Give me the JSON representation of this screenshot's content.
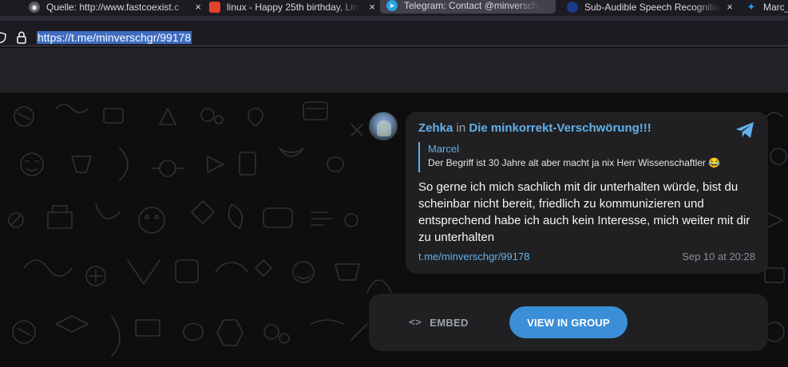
{
  "browser": {
    "tabs": [
      {
        "label": "Quelle: http://www.fastcoexist.c",
        "icon": "globe-icon"
      },
      {
        "label": "linux - Happy 25th birthday, Lin",
        "icon": "gitlab-fox-icon"
      },
      {
        "label": "Telegram: Contact @minverschgr",
        "icon": "telegram-icon",
        "active": true
      },
      {
        "label": "Sub-Audible Speech Recognitio",
        "icon": "nasa-icon"
      },
      {
        "label": "Marc_",
        "icon": "twitter-icon"
      }
    ],
    "url": "https://t.me/minverschgr/99178"
  },
  "message": {
    "author": "Zehka",
    "in_word": "in",
    "group": "Die minkorrekt-Verschwörung!!!",
    "reply_name": "Marcel",
    "reply_text": "Der Begriff ist 30 Jahre alt aber macht ja nix Herr Wissenschaftler 😂",
    "text": "So gerne ich mich sachlich mit dir unterhalten würde, bist du scheinbar nicht bereit, friedlich zu kommunizieren und entsprechend habe ich auch kein Interesse, mich weiter mit dir zu unterhalten",
    "link": "t.me/minverschgr/99178",
    "time": "Sep 10 at 20:28"
  },
  "actions": {
    "embed_icon": "<>",
    "embed_label": "EMBED",
    "view_label": "VIEW IN GROUP"
  },
  "colors": {
    "accent": "#63b0eb",
    "button": "#3a8fd8",
    "bubble": "#202022"
  }
}
